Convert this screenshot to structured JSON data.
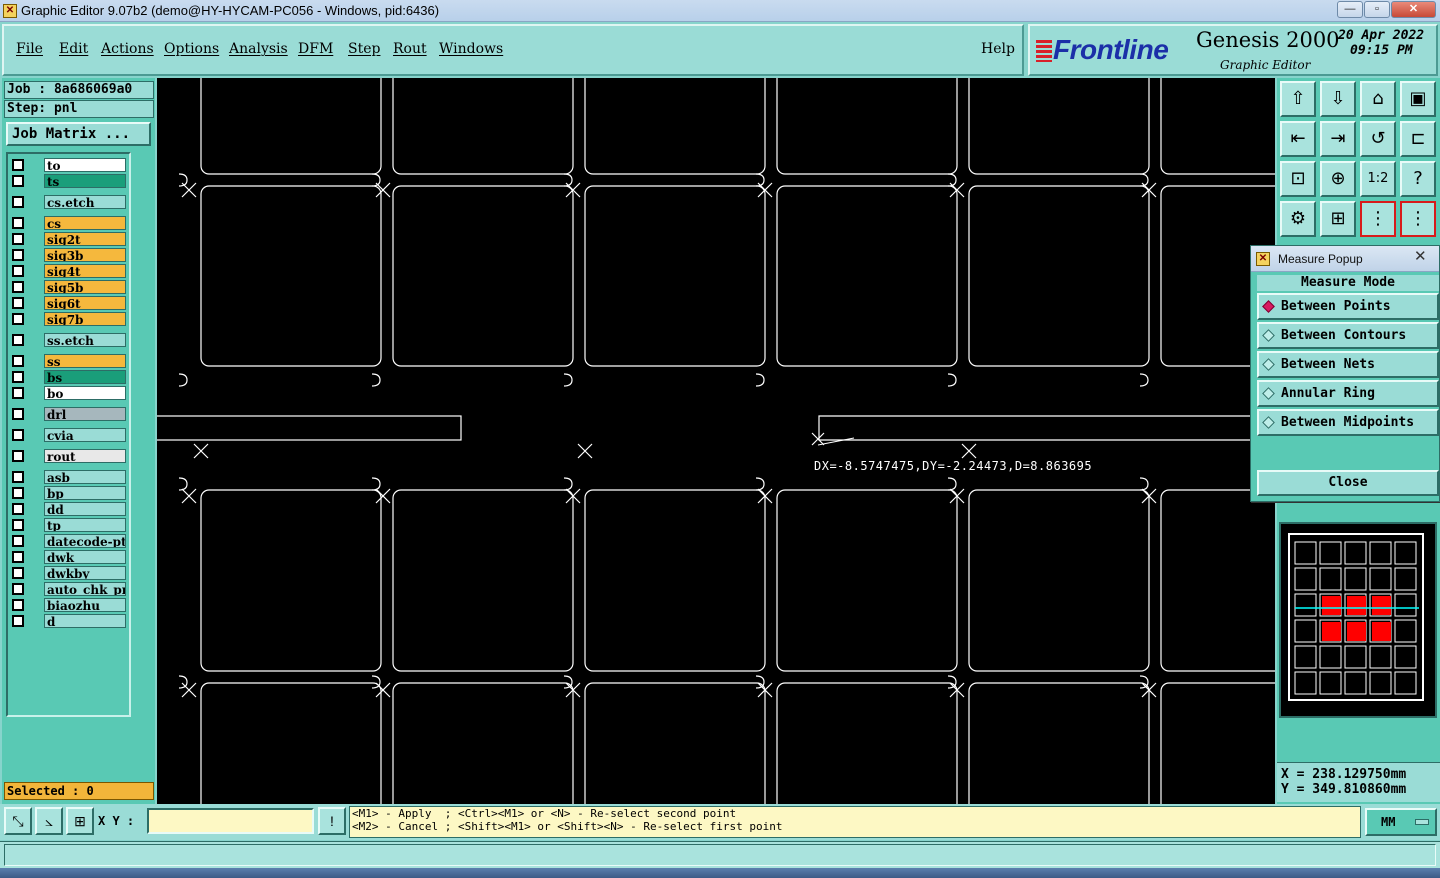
{
  "window": {
    "title": "Graphic Editor 9.07b2 (demo@HY-HYCAM-PC056 - Windows, pid:6436)",
    "minimize_label": "—",
    "maximize_label": "▫",
    "close_label": "✕"
  },
  "menu": {
    "items": [
      "File",
      "Edit",
      "Actions",
      "Options",
      "Analysis",
      "DFM",
      "Step",
      "Rout",
      "Windows"
    ],
    "help": "Help"
  },
  "brand": {
    "logo": "Frontline",
    "product": "Genesis 2000",
    "subtitle": "Graphic Editor",
    "date": "20 Apr 2022",
    "time": "09:15 PM"
  },
  "job": {
    "job_line": "Job : 8a686069a0",
    "step_line": "Step: pnl",
    "matrix_button": "Job Matrix ..."
  },
  "layers": [
    {
      "name": "to",
      "color": "#ffffff"
    },
    {
      "name": "ts",
      "color": "#1a9e7a"
    },
    {
      "name": "cs.etch",
      "color": "#9adcd6"
    },
    {
      "name": "cs",
      "color": "#f5b83d"
    },
    {
      "name": "sig2t",
      "color": "#f5b83d"
    },
    {
      "name": "sig3b",
      "color": "#f5b83d"
    },
    {
      "name": "sig4t",
      "color": "#f5b83d"
    },
    {
      "name": "sig5b",
      "color": "#f5b83d"
    },
    {
      "name": "sig6t",
      "color": "#f5b83d"
    },
    {
      "name": "sig7b",
      "color": "#f5b83d"
    },
    {
      "name": "ss.etch",
      "color": "#9adcd6"
    },
    {
      "name": "ss",
      "color": "#f5b83d"
    },
    {
      "name": "bs",
      "color": "#1a9e7a"
    },
    {
      "name": "bo",
      "color": "#ffffff"
    },
    {
      "name": "drl",
      "color": "#a6b7bd"
    },
    {
      "name": "cvia",
      "color": "#9adcd6"
    },
    {
      "name": "rout",
      "color": "#e8e8e8"
    },
    {
      "name": "asb",
      "color": "#9adcd6"
    },
    {
      "name": "bp",
      "color": "#9adcd6"
    },
    {
      "name": "dd",
      "color": "#9adcd6"
    },
    {
      "name": "tp",
      "color": "#9adcd6"
    },
    {
      "name": "datecode-ptc",
      "color": "#9adcd6"
    },
    {
      "name": "dwk",
      "color": "#9adcd6"
    },
    {
      "name": "dwkby",
      "color": "#9adcd6"
    },
    {
      "name": "auto_chk_pnl",
      "color": "#9adcd6"
    },
    {
      "name": "biaozhu",
      "color": "#9adcd6"
    },
    {
      "name": "d",
      "color": "#9adcd6"
    }
  ],
  "selected_count": "Selected : 0",
  "measure_readout": "DX=-8.5747475,DY=-2.24473,D=8.863695",
  "measure_popup": {
    "title": "Measure Popup",
    "close_x": "✕",
    "mode_header": "Measure Mode",
    "options": [
      {
        "label": "Between Points",
        "selected": true
      },
      {
        "label": "Between Contours",
        "selected": false
      },
      {
        "label": "Between Nets",
        "selected": false
      },
      {
        "label": "Annular Ring",
        "selected": false
      },
      {
        "label": "Between Midpoints",
        "selected": false
      }
    ],
    "close_button": "Close"
  },
  "toolbar_icons": [
    "zoom-home-icon",
    "zoom-back-icon",
    "home-step-icon",
    "window-split-icon",
    "pan-left-icon",
    "pan-right-icon",
    "redraw-icon",
    "snap-icon",
    "fit-profile-icon",
    "fit-screen-icon",
    "zoom-one-to-two-icon",
    "help-query-icon",
    "layer-settings-icon",
    "grid-view-icon",
    "display-layers-icon",
    "display-features-icon"
  ],
  "toolbar_glyphs": [
    "⇧",
    "⇩",
    "⌂",
    "▣",
    "⇤",
    "⇥",
    "↺",
    "⊏",
    "⊡",
    "⊕",
    "1:2",
    "?",
    "⚙",
    "⊞",
    "⋮",
    "⋮"
  ],
  "coords": {
    "x": "X  = 238.129750mm",
    "y": "Y  = 349.810860mm"
  },
  "bottom": {
    "xy_label": "X Y :",
    "xy_value": "",
    "alert_glyph": "!",
    "prompt_line1": "<M1> - Apply  ; <Ctrl><M1> or <N> - Re-select second point",
    "prompt_line2": "<M2> - Cancel ; <Shift><M1> or <Shift><N> - Re-select first point",
    "units": "MM"
  },
  "colors": {
    "panel": "#59c9b4",
    "canvas": "#000000",
    "selected_layer_highlight": "#f5b83d",
    "overview_highlight": "#ff0000"
  }
}
